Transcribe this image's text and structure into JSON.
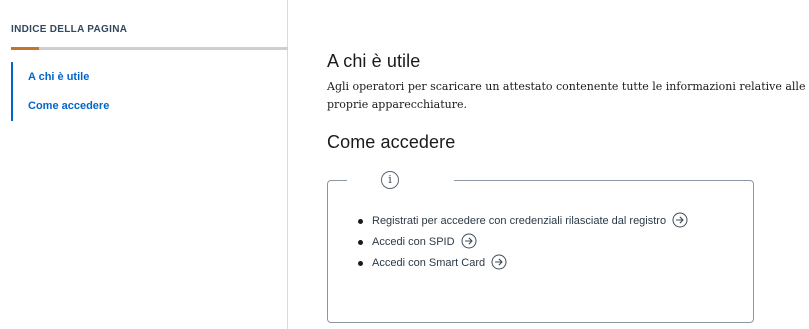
{
  "sidebar": {
    "title": "INDICE DELLA PAGINA",
    "progress": 0.1,
    "items": [
      {
        "label": "A chi è utile"
      },
      {
        "label": "Come accedere"
      }
    ]
  },
  "main": {
    "section_who": {
      "title": "A chi è utile",
      "text": "Agli operatori per scaricare un attestato contenente tutte le informazioni relative alle proprie apparecchiature."
    },
    "section_how": {
      "title": "Come accedere",
      "callout_icon": "info-icon",
      "items": [
        {
          "label": "Registrati per accedere con credenziali rilasciate dal registro",
          "icon": "arrow-right-circle-icon"
        },
        {
          "label": "Accedi con SPID",
          "icon": "arrow-right-circle-icon"
        },
        {
          "label": "Accedi con Smart Card",
          "icon": "arrow-right-circle-icon"
        }
      ]
    }
  },
  "colors": {
    "link": "#0066cc",
    "progress_fill": "#c4742d",
    "progress_track": "#cdd0d3",
    "callout_border": "#8a97a3"
  }
}
